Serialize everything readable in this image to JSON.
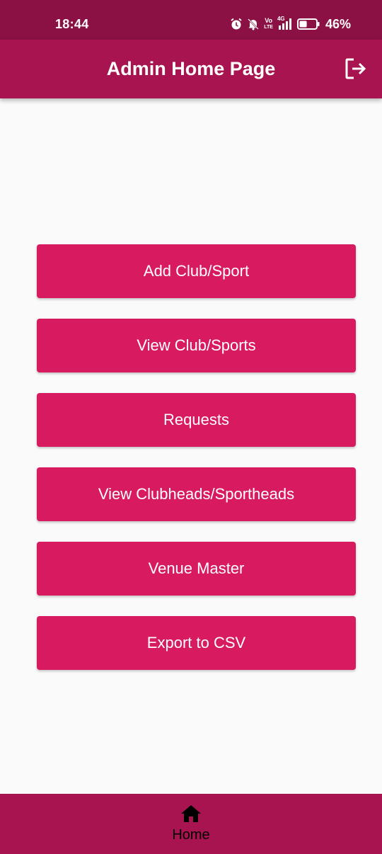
{
  "status_bar": {
    "time": "18:44",
    "volte_top": "Vo",
    "volte_bottom": "LTE",
    "network": "4G",
    "battery_percent": "46%",
    "battery_level": 0.46,
    "icons": [
      "alarm-icon",
      "mute-icon",
      "volte-icon",
      "signal-icon",
      "battery-icon"
    ]
  },
  "app_bar": {
    "title": "Admin Home Page",
    "action_icon": "logout-icon"
  },
  "menu": {
    "buttons": [
      {
        "label": "Add Club/Sport"
      },
      {
        "label": "View Club/Sports"
      },
      {
        "label": "Requests"
      },
      {
        "label": "View Clubheads/Sportheads"
      },
      {
        "label": "Venue Master"
      },
      {
        "label": "Export to CSV"
      }
    ]
  },
  "bottom_nav": {
    "home_label": "Home",
    "home_icon": "home-icon"
  },
  "colors": {
    "status_bar": "#8B1144",
    "app_bar": "#A8144F",
    "button": "#D81B60",
    "background": "#FAFAFA"
  }
}
